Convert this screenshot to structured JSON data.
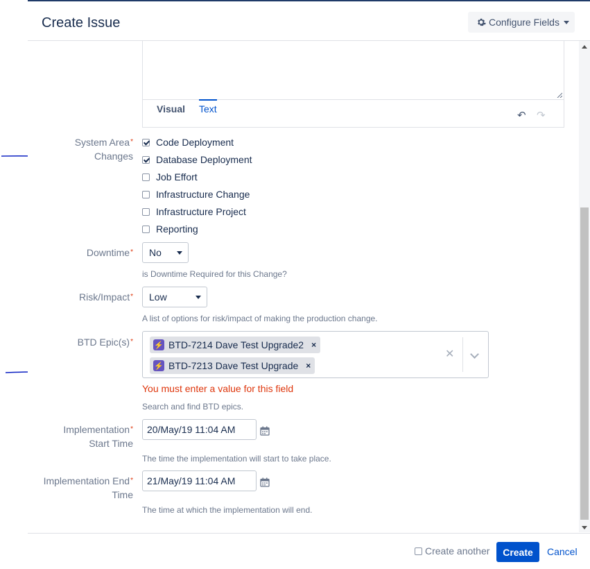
{
  "dialog": {
    "title": "Create Issue",
    "configure_fields": "Configure Fields"
  },
  "editor": {
    "tabs": [
      {
        "label": "Visual",
        "active": false
      },
      {
        "label": "Text",
        "active": true
      }
    ],
    "undo_icon": "undo-icon",
    "redo_icon": "redo-icon"
  },
  "fields": {
    "system_area": {
      "label_line1": "System Area",
      "label_line2": "Changes",
      "options": [
        {
          "label": "Code Deployment",
          "checked": true
        },
        {
          "label": "Database Deployment",
          "checked": true
        },
        {
          "label": "Job Effort",
          "checked": false
        },
        {
          "label": "Infrastructure Change",
          "checked": false
        },
        {
          "label": "Infrastructure Project",
          "checked": false
        },
        {
          "label": "Reporting",
          "checked": false
        }
      ]
    },
    "downtime": {
      "label": "Downtime",
      "value": "No",
      "help": "is Downtime Required for this Change?"
    },
    "risk_impact": {
      "label": "Risk/Impact",
      "value": "Low",
      "help": "A list of options for risk/impact of making the production change."
    },
    "btd_epics": {
      "label": "BTD Epic(s)",
      "chips": [
        {
          "label": "BTD-7214 Dave Test Upgrade2"
        },
        {
          "label": "BTD-7213 Dave Test Upgrade"
        }
      ],
      "error": "You must enter a value for this field",
      "help": "Search and find BTD epics."
    },
    "impl_start": {
      "label_line1": "Implementation",
      "label_line2": "Start Time",
      "value": "20/May/19 11:04 AM",
      "help": "The time the implementation will start to take place."
    },
    "impl_end": {
      "label_line1": "Implementation End",
      "label_line2": "Time",
      "value": "21/May/19 11:04 AM",
      "help": "The time at which the implementation will end."
    }
  },
  "footer": {
    "create_another": "Create another",
    "create": "Create",
    "cancel": "Cancel"
  },
  "colors": {
    "primary": "#0052cc",
    "error": "#de350b",
    "epic": "#6554c0",
    "annotation": "#0a1fc2"
  }
}
